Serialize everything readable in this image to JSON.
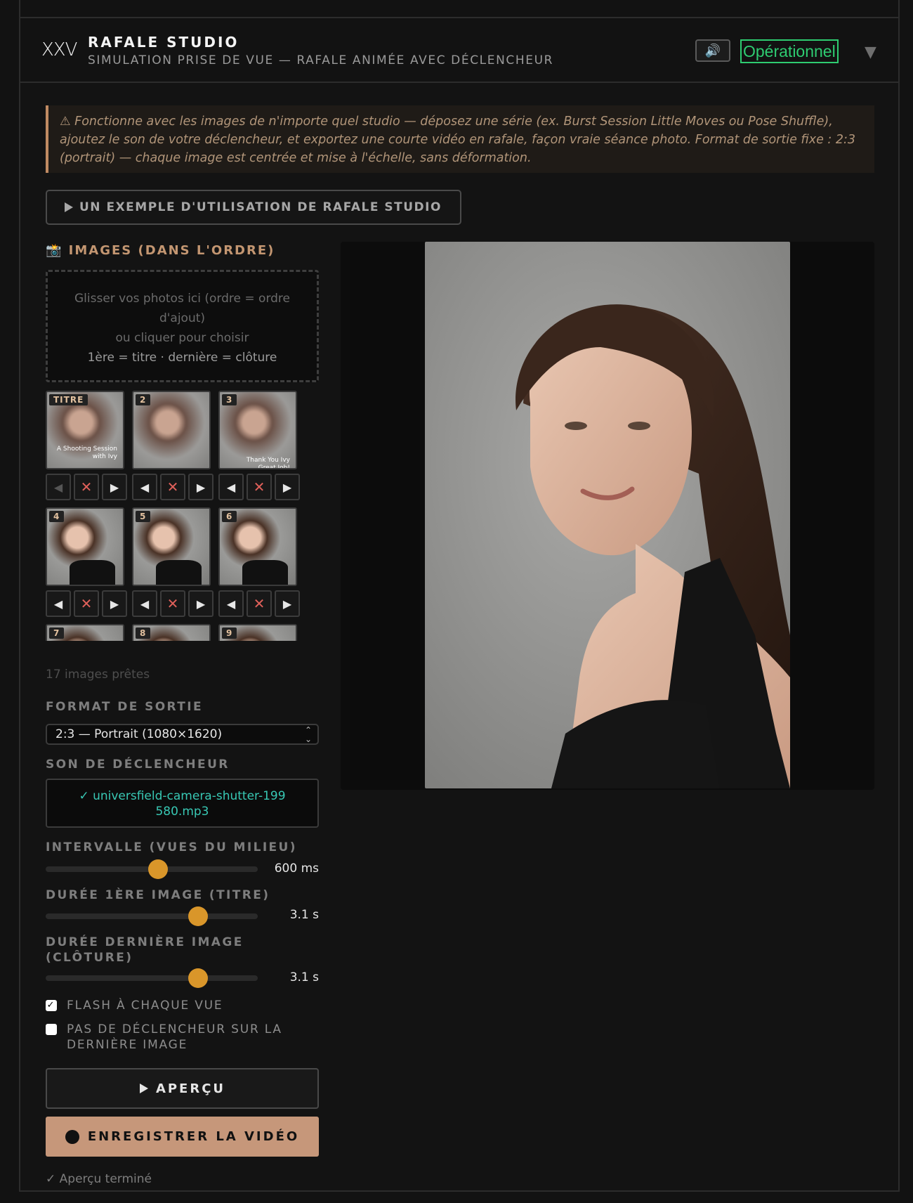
{
  "header": {
    "logo": "XXV",
    "title": "RAFALE STUDIO",
    "subtitle": "SIMULATION PRISE DE VUE — RAFALE ANIMÉE AVEC DÉCLENCHEUR",
    "sound_icon": "🔊",
    "status": "Opérationnel",
    "chevron": "▼"
  },
  "notice": "⚠ Fonctionne avec les images de n'importe quel studio — déposez une série (ex. Burst Session Little Moves ou Pose Shuffle), ajoutez le son de votre déclencheur, et exportez une courte vidéo en rafale, façon vraie séance photo. Format de sortie fixe : 2:3 (portrait) — chaque image est centrée et mise à l'échelle, sans déformation.",
  "example_button": "UN EXEMPLE D'UTILISATION DE RAFALE STUDIO",
  "images": {
    "title": "📸 IMAGES (DANS L'ORDRE)",
    "drop_line1": "Glisser vos photos ici (ordre = ordre d'ajout)",
    "drop_line2": "ou cliquer pour choisir",
    "drop_line3": "1ère = titre · dernière = clôture",
    "thumbs": [
      {
        "badge": "TITRE",
        "caption": "A Shooting Session with Ivy"
      },
      {
        "badge": "2",
        "caption": ""
      },
      {
        "badge": "3",
        "caption": "Thank You Ivy Great Job!"
      },
      {
        "badge": "4",
        "caption": ""
      },
      {
        "badge": "5",
        "caption": ""
      },
      {
        "badge": "6",
        "caption": ""
      },
      {
        "badge": "7",
        "caption": ""
      },
      {
        "badge": "8",
        "caption": ""
      },
      {
        "badge": "9",
        "caption": ""
      }
    ],
    "ready": "17 images prêtes"
  },
  "format": {
    "label": "FORMAT DE SORTIE",
    "selected": "2:3 — Portrait (1080×1620)"
  },
  "shutter": {
    "label": "SON DE DÉCLENCHEUR",
    "file": "✓ universfield-camera-shutter-199580.mp3"
  },
  "sliders": {
    "interval": {
      "label": "INTERVALLE (VUES DU MILIEU)",
      "value": "600 ms",
      "fraction": 0.53
    },
    "first": {
      "label": "DURÉE 1ÈRE IMAGE (TITRE)",
      "value": "3.1 s",
      "fraction": 0.72
    },
    "last": {
      "label": "DURÉE DERNIÈRE IMAGE (CLÔTURE)",
      "value": "3.1 s",
      "fraction": 0.72
    }
  },
  "options": {
    "flash": {
      "label": "FLASH À CHAQUE VUE",
      "checked": true
    },
    "no_shutter_last": {
      "label": "PAS DE DÉCLENCHEUR SUR LA DERNIÈRE IMAGE",
      "checked": false
    }
  },
  "actions": {
    "preview": "APERÇU",
    "record": "ENREGISTRER LA VIDÉO",
    "status": "✓ Aperçu terminé"
  },
  "colors": {
    "accent": "#c6977a",
    "status_green": "#2ecc71",
    "slider_knob": "#d9962a",
    "file_teal": "#38c8b4"
  }
}
